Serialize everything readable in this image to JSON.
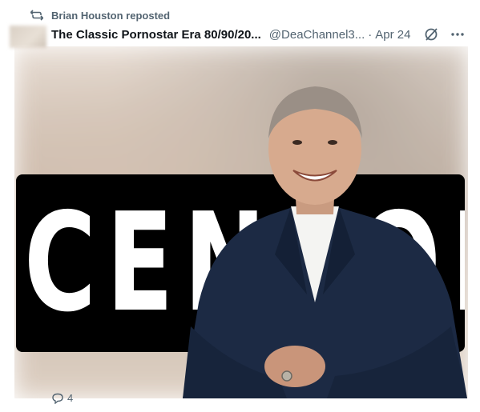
{
  "repost": {
    "icon": "repost-icon",
    "text": "Brian Houston reposted"
  },
  "post": {
    "author_name": "The Classic Pornostar Era 80/90/20...",
    "handle": "@DeaChannel3...",
    "separator": "·",
    "date": "Apr 24",
    "censor_text": "CENSORED"
  },
  "actions": {
    "reply_count": "4"
  },
  "colors": {
    "text": "#0f1419",
    "secondary": "#536471",
    "censor": "#000000",
    "suit": "#1c2a44"
  }
}
